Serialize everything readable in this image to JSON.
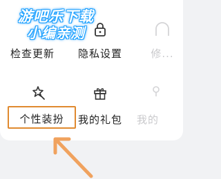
{
  "watermark": {
    "line1": "游吧乐下载",
    "line2": "小编亲测"
  },
  "grid": {
    "items": [
      {
        "label": "检查更新",
        "icon": "check-update-icon"
      },
      {
        "label": "隐私设置",
        "icon": "lock-icon"
      },
      {
        "label": "修...",
        "icon": "cut-off-icon"
      },
      {
        "label": "个性装扮",
        "icon": "magic-wand-icon"
      },
      {
        "label": "我的礼包",
        "icon": "gift-icon"
      },
      {
        "label": "我的",
        "icon": "cut-off-icon"
      }
    ]
  },
  "colors": {
    "highlight": "#e0892e",
    "arrow": "#f0a25e",
    "watermark_glow": "#1aa0ff"
  }
}
